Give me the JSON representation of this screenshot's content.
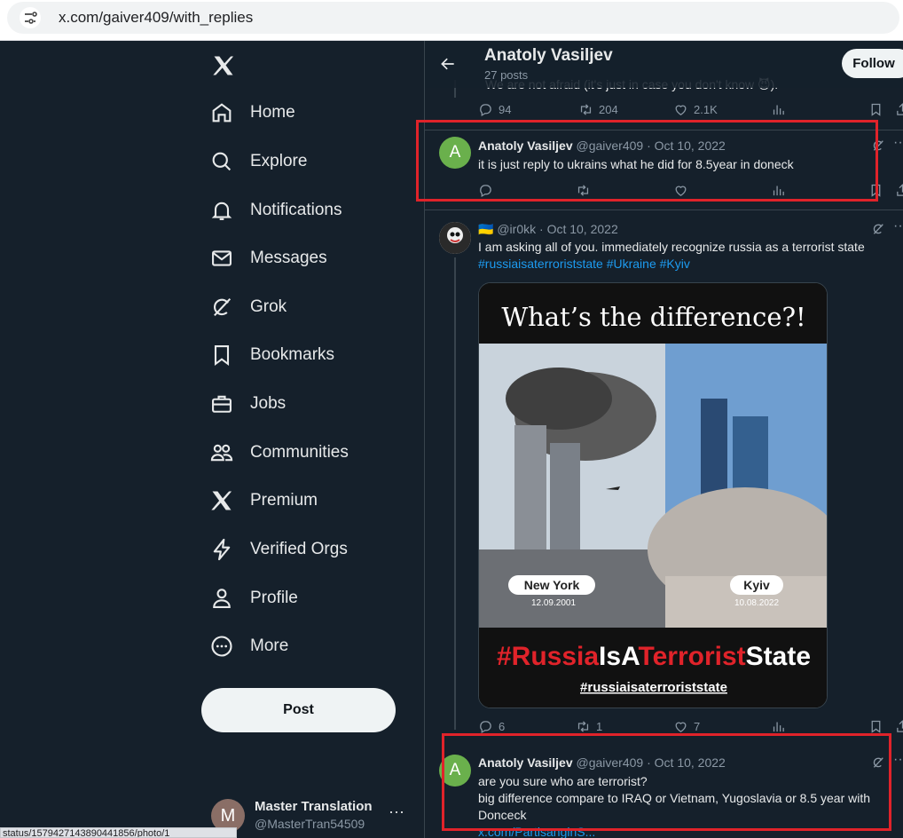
{
  "browser": {
    "url": "x.com/gaiver409/with_replies"
  },
  "nav": [
    {
      "key": "home",
      "label": "Home",
      "icon": "home-icon"
    },
    {
      "key": "explore",
      "label": "Explore",
      "icon": "search-icon"
    },
    {
      "key": "notifications",
      "label": "Notifications",
      "icon": "bell-icon"
    },
    {
      "key": "messages",
      "label": "Messages",
      "icon": "mail-icon"
    },
    {
      "key": "grok",
      "label": "Grok",
      "icon": "grok-icon"
    },
    {
      "key": "bookmarks",
      "label": "Bookmarks",
      "icon": "bookmark-icon"
    },
    {
      "key": "jobs",
      "label": "Jobs",
      "icon": "briefcase-icon"
    },
    {
      "key": "communities",
      "label": "Communities",
      "icon": "people-icon"
    },
    {
      "key": "premium",
      "label": "Premium",
      "icon": "x-logo-icon"
    },
    {
      "key": "verified",
      "label": "Verified Orgs",
      "icon": "lightning-icon"
    },
    {
      "key": "profile",
      "label": "Profile",
      "icon": "person-icon"
    },
    {
      "key": "more",
      "label": "More",
      "icon": "more-circle-icon"
    }
  ],
  "post_button": "Post",
  "account": {
    "avatar_letter": "M",
    "name": "Master Translation",
    "handle": "@MasterTran54509"
  },
  "status_url": "status/1579427143890441856/photo/1",
  "header": {
    "title": "Anatoly Vasiljev",
    "subtitle": "27 posts",
    "follow_label": "Follow"
  },
  "prev_post": {
    "text": "We are not afraid (it's just in case you don't know 😈).",
    "replies": "94",
    "reposts": "204",
    "likes": "2.1K"
  },
  "reply1": {
    "avatar_letter": "A",
    "name": "Anatoly Vasiljev",
    "handle": "@gaiver409",
    "sep": "·",
    "date": "Oct 10, 2022",
    "text": "it is just reply to ukrains what he did for 8.5year in doneck"
  },
  "post2": {
    "flag": "🇺🇦",
    "handle": "@ir0kk",
    "sep": "·",
    "date": "Oct 10, 2022",
    "text": "I am asking all of you. immediately recognize russia as a terrorist state",
    "tags": "#russiaisaterroriststate #Ukraine #Kyiv",
    "image": {
      "title": "What’s the difference?!",
      "left_city": "New York",
      "left_date": "12.09.2001",
      "right_city": "Kyiv",
      "right_date": "10.08.2022",
      "banner_a": "#Russia",
      "banner_b": "IsA",
      "banner_c": "Terrorist",
      "banner_d": "State",
      "hashtag": "#russiaisaterroriststate"
    },
    "replies": "6",
    "reposts": "1",
    "likes": "7"
  },
  "reply2": {
    "avatar_letter": "A",
    "name": "Anatoly Vasiljev",
    "handle": "@gaiver409",
    "sep": "·",
    "date": "Oct 10, 2022",
    "line1": "are you sure who are terrorist?",
    "line2": "big difference compare to IRAQ or Vietnam, Yugoslavia or 8.5 year  with Donceck",
    "link": "x.com/PartisanginS..."
  },
  "colors": {
    "bg": "#15202b",
    "border": "#38444d",
    "muted": "#8b98a5",
    "accent": "#1d9bf0",
    "highlight": "#e0232a"
  }
}
